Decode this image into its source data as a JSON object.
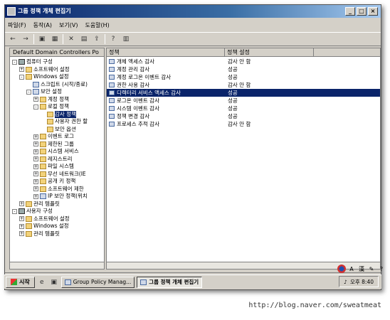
{
  "window": {
    "title": "그룹 정책 개체 편집기"
  },
  "menu": [
    "파일(F)",
    "동작(A)",
    "보기(V)",
    "도움말(H)"
  ],
  "toolbar": [
    {
      "icon": "back-icon",
      "glyph": "←"
    },
    {
      "icon": "forward-icon",
      "glyph": "→"
    },
    {
      "icon": "up-folder-icon",
      "glyph": "▣"
    },
    {
      "icon": "show-tree-icon",
      "glyph": "▦"
    },
    {
      "icon": "delete-icon",
      "glyph": "✕"
    },
    {
      "icon": "properties-icon",
      "glyph": "▤"
    },
    {
      "icon": "export-icon",
      "glyph": "⇪"
    },
    {
      "icon": "help-icon",
      "glyph": "?"
    },
    {
      "icon": "view-icon",
      "glyph": "▥"
    }
  ],
  "tree": {
    "header": "Default Domain Controllers Po",
    "items": [
      {
        "label": "컴퓨터 구성",
        "indent": 0,
        "toggle": "-",
        "icon": "computer"
      },
      {
        "label": "소프트웨어 설정",
        "indent": 1,
        "toggle": "+",
        "icon": "folder"
      },
      {
        "label": "Windows 설정",
        "indent": 1,
        "toggle": "-",
        "icon": "folder"
      },
      {
        "label": "스크립트 (시작/종료)",
        "indent": 2,
        "toggle": "",
        "icon": "policy"
      },
      {
        "label": "보안 설정",
        "indent": 2,
        "toggle": "-",
        "icon": "policy"
      },
      {
        "label": "계정 정책",
        "indent": 3,
        "toggle": "+",
        "icon": "folder"
      },
      {
        "label": "로컬 정책",
        "indent": 3,
        "toggle": "-",
        "icon": "folder"
      },
      {
        "label": "감사 정책",
        "indent": 4,
        "toggle": "",
        "icon": "folder",
        "selected": true
      },
      {
        "label": "사용자 권한 할",
        "indent": 4,
        "toggle": "",
        "icon": "folder"
      },
      {
        "label": "보안 옵션",
        "indent": 4,
        "toggle": "",
        "icon": "folder"
      },
      {
        "label": "이벤트 로그",
        "indent": 3,
        "toggle": "+",
        "icon": "folder"
      },
      {
        "label": "제한된 그룹",
        "indent": 3,
        "toggle": "+",
        "icon": "folder"
      },
      {
        "label": "시스템 서비스",
        "indent": 3,
        "toggle": "+",
        "icon": "folder"
      },
      {
        "label": "레지스트리",
        "indent": 3,
        "toggle": "+",
        "icon": "folder"
      },
      {
        "label": "파일 시스템",
        "indent": 3,
        "toggle": "+",
        "icon": "folder"
      },
      {
        "label": "무선 네트워크(IE",
        "indent": 3,
        "toggle": "+",
        "icon": "folder"
      },
      {
        "label": "공개 키 정책",
        "indent": 3,
        "toggle": "+",
        "icon": "folder"
      },
      {
        "label": "소프트웨어 제한",
        "indent": 3,
        "toggle": "+",
        "icon": "folder"
      },
      {
        "label": "IP 보안 정책(위치",
        "indent": 3,
        "toggle": "+",
        "icon": "policy"
      },
      {
        "label": "관리 템플릿",
        "indent": 1,
        "toggle": "+",
        "icon": "folder"
      },
      {
        "label": "사용자 구성",
        "indent": 0,
        "toggle": "-",
        "icon": "computer"
      },
      {
        "label": "소프트웨어 설정",
        "indent": 1,
        "toggle": "+",
        "icon": "folder"
      },
      {
        "label": "Windows 설정",
        "indent": 1,
        "toggle": "+",
        "icon": "folder"
      },
      {
        "label": "관리 템플릿",
        "indent": 1,
        "toggle": "+",
        "icon": "folder"
      }
    ]
  },
  "table": {
    "headers": [
      "정책",
      "정책 설정"
    ],
    "rows": [
      {
        "name": "개체 액세스 감사",
        "setting": "감사 안 함"
      },
      {
        "name": "계정 관리 감사",
        "setting": "성공"
      },
      {
        "name": "계정 로그온 이벤트 감사",
        "setting": "성공"
      },
      {
        "name": "권한 사용 감사",
        "setting": "감사 안 함"
      },
      {
        "name": "디렉터리 서비스 액세스 감사",
        "setting": "성공",
        "selected": true
      },
      {
        "name": "로그온 이벤트 감사",
        "setting": "성공"
      },
      {
        "name": "시스템 이벤트 감사",
        "setting": "성공"
      },
      {
        "name": "정책 변경 감사",
        "setting": "성공"
      },
      {
        "name": "프로세스 추적 감사",
        "setting": "감사 안 함"
      }
    ]
  },
  "ime": [
    "A",
    "漢"
  ],
  "taskbar": {
    "start": "시작",
    "tasks": [
      {
        "label": "Group Policy Manag...",
        "active": false
      },
      {
        "label": "그룹 정책 개체 편집기",
        "active": true
      }
    ],
    "clock": "오후 8:40"
  },
  "watermark": "http://blog.naver.com/sweatmeat"
}
